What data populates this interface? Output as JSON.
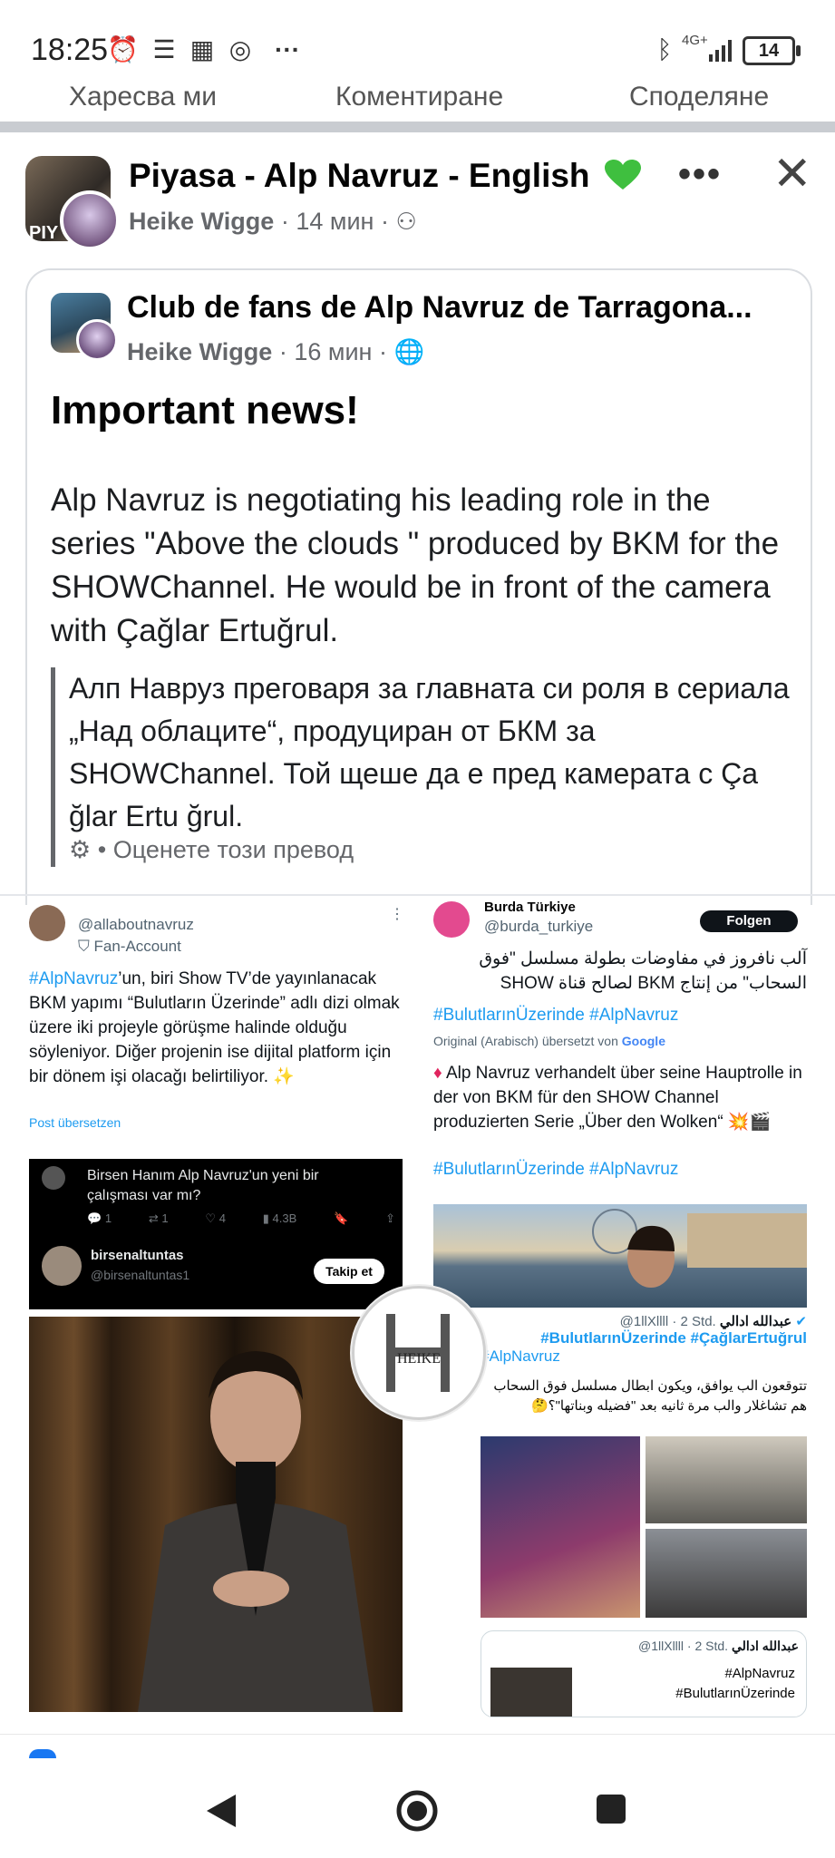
{
  "status_bar": {
    "time": "18:25",
    "network": "4G+",
    "battery": "14"
  },
  "actions": {
    "like": "Харесва ми",
    "comment": "Коментиране",
    "share": "Споделяне"
  },
  "post": {
    "title": "Piyasa - Alp Navruz - English",
    "avatar_label": "PIY",
    "author": "Heike Wigge",
    "time": "14 мин",
    "sep": "·"
  },
  "shared": {
    "group": "Club de fans de Alp Navruz de Tarragona...",
    "author": "Heike Wigge",
    "time": "16 мин",
    "headline": "Important news!",
    "body": "Alp Navruz is negotiating his leading role in the series \"Above the clouds \" produced by BKM for the SHOWChannel. He would be in front of the camera with Çağlar Ertuğrul.",
    "translation": "Алп Навруз преговаря за главната си роля в сериала „Над облаците“, продуциран от БКМ за SHOWChannel. Той щеше да е пред камерата с Ça ğlar Ertu ğrul.",
    "rate": "• Оценете този превод"
  },
  "collage": {
    "left_tweet": {
      "handle": "@allaboutnavruz",
      "badge": "Fan-Account",
      "hashtag": "#AlpNavruz",
      "text": "’un, biri Show TV’de yayınlanacak BKM yapımı “Bulutların Üzerinde” adlı dizi olmak üzere iki projeyle görüşme halinde olduğu söyleniyor. Diğer projenin ise dijital platform için bir dönem işi olacağı belirtiliyor. ✨",
      "translate": "Post übersetzen"
    },
    "black_card": {
      "text": "Birsen Hanım Alp Navruz'un yeni bir çalışması var mı?",
      "stats": [
        "1",
        "1",
        "4",
        "4.3B"
      ],
      "name": "birsenaltuntas",
      "handle": "@birsenaltuntas1",
      "follow": "Takip et"
    },
    "right_tweet": {
      "name": "Burda Türkiye",
      "handle": "@burda_turkiye",
      "follow": "Folgen",
      "arabic": "آلب نافروز في مفاوضات بطولة مسلسل \"فوق السحاب\" من إنتاج BKM لصالح قناة SHOW",
      "hashtags": "#BulutlarınÜzerinde #AlpNavruz",
      "translated_note": "Original (Arabisch) übersetzt von",
      "google": "Google",
      "german": "Alp Navruz verhandelt über seine Hauptrolle in der von BKM für den SHOW Channel produzierten Serie „Über den Wolken“ 💥🎬",
      "hashtags2": "#BulutlarınÜzerinde #AlpNavruz"
    },
    "arabic_tweet": {
      "name": "عبدالله ادالي",
      "handle": "@1llXllll · 2 Std.",
      "hashtags_a": "#BulutlarınÜzerinde #ÇağlarErtuğrul",
      "hashtags_b": "#AlpNavruz",
      "text": "تتوقعون الب يوافق، ويكون ابطال مسلسل فوق السحاب هم تشاغلار والب مرة ثانيه بعد \"فضيله وبناتها\"؟🤔"
    },
    "quote_card": {
      "name": "عبدالله ادالي",
      "handle": "@1llXllll · 2 Std.",
      "tag1": "#AlpNavruz",
      "tag2": "#BulutlarınÜzerinde"
    },
    "watermark": "HEIKE"
  },
  "colors": {
    "link": "#1d9bf0",
    "heart": "#3fbf3f",
    "fb_gray": "#65676b"
  }
}
